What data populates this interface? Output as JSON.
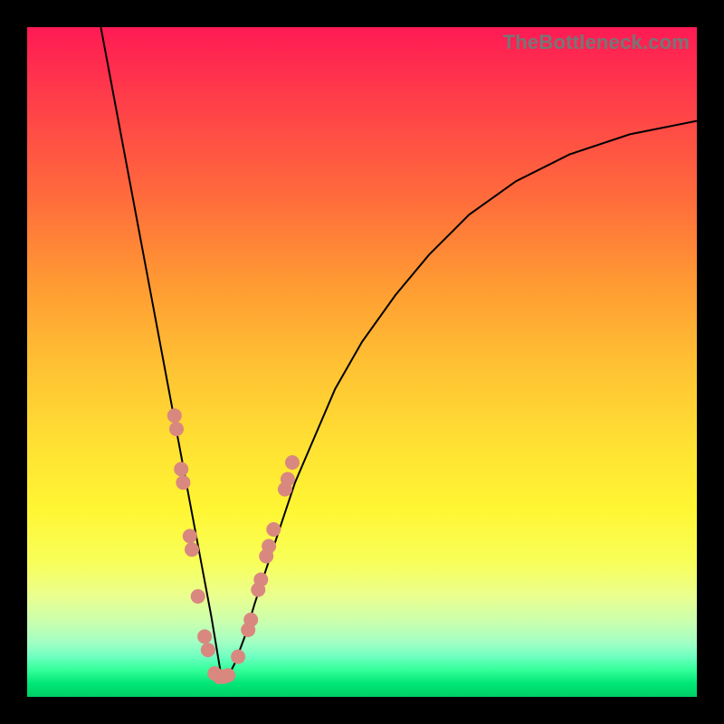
{
  "watermark": "TheBottleneck.com",
  "colors": {
    "frame_bg_top": "#ff1a54",
    "frame_bg_bottom": "#00d166",
    "border": "#000000",
    "curve": "#000000",
    "marker": "#d98880",
    "watermark": "#767676"
  },
  "chart_data": {
    "type": "line",
    "title": "",
    "xlabel": "",
    "ylabel": "",
    "xlim": [
      0,
      100
    ],
    "ylim": [
      0,
      100
    ],
    "note": "Axes are unlabeled; x/y values estimated from pixel positions on a 0–100 normalized scale. Curve is a V-shaped bottleneck plot with minimum near x≈29.",
    "series": [
      {
        "name": "bottleneck-curve",
        "x": [
          11,
          12.5,
          14,
          15.5,
          17,
          18.5,
          20,
          21.5,
          23,
          24.5,
          26,
          27.5,
          28.5,
          29,
          30,
          31,
          32.5,
          34,
          36,
          38,
          40,
          43,
          46,
          50,
          55,
          60,
          66,
          73,
          81,
          90,
          100
        ],
        "y": [
          100,
          92,
          84,
          76,
          68,
          60,
          52,
          44,
          36,
          28,
          20,
          12,
          6,
          3,
          3,
          5,
          9,
          14,
          20,
          26,
          32,
          39,
          46,
          53,
          60,
          66,
          72,
          77,
          81,
          84,
          86
        ]
      }
    ],
    "markers": {
      "name": "highlighted-points",
      "color": "#d98880",
      "points_xy": [
        [
          22.0,
          42
        ],
        [
          22.3,
          40
        ],
        [
          23.0,
          34
        ],
        [
          23.3,
          32
        ],
        [
          24.3,
          24
        ],
        [
          24.6,
          22
        ],
        [
          25.5,
          15
        ],
        [
          26.5,
          9
        ],
        [
          27.0,
          7
        ],
        [
          28.0,
          3.5
        ],
        [
          28.7,
          3
        ],
        [
          29.3,
          3
        ],
        [
          30.0,
          3.2
        ],
        [
          31.5,
          6
        ],
        [
          33.0,
          10
        ],
        [
          33.4,
          11.5
        ],
        [
          34.5,
          16
        ],
        [
          34.9,
          17.5
        ],
        [
          35.7,
          21
        ],
        [
          36.1,
          22.5
        ],
        [
          36.8,
          25
        ],
        [
          38.5,
          31
        ],
        [
          38.9,
          32.5
        ],
        [
          39.6,
          35
        ]
      ]
    }
  }
}
